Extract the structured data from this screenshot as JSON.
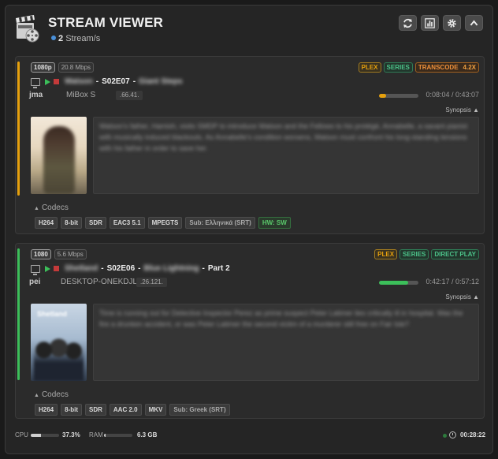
{
  "header": {
    "title": "STREAM VIEWER",
    "stream_count": "2",
    "stream_suffix": "Stream/s",
    "buttons": [
      "refresh-icon",
      "chart-icon",
      "gear-icon",
      "chevron-up-icon"
    ]
  },
  "streams": [
    {
      "resolution": "1080p",
      "bitrate": "20.8 Mbps",
      "tags": {
        "server": "PLEX",
        "type": "SERIES",
        "mode": "TRANSCODE",
        "speed": "4.2X"
      },
      "show": "Watson",
      "episode": "S02E07",
      "episode_title": "Giant Steps",
      "user": "jma",
      "device": "MiBox S",
      "ip": ".66.41.",
      "progress": 0.17,
      "time": "0:08:04 / 0:43:07",
      "synopsis_label": "Synopsis",
      "synopsis": "Watson's father, Hamish, visits SMDP to introduce Watson and the Fellows to his protégé, Annabelle, a savant pianist with musically induced blackouts. As Annabelle's condition worsens, Watson must confront his long-standing tensions with his father in order to save her.",
      "codecs_label": "Codecs",
      "codecs": [
        "H264",
        "8-bit",
        "SDR",
        "EAC3 5.1",
        "MPEGTS"
      ],
      "subtitle": "Sub: Ελληνικά (SRT)",
      "hw": "HW: SW",
      "accent": "#e5a00d",
      "progress_color": "#e5a00d"
    },
    {
      "resolution": "1080",
      "bitrate": "5.6 Mbps",
      "tags": {
        "server": "PLEX",
        "type": "SERIES",
        "mode": "DIRECT PLAY"
      },
      "show": "Shetland",
      "episode": "S02E06",
      "episode_title": "Blue Lightning",
      "episode_part": "Part 2",
      "user": "pei",
      "device": "DESKTOP-ONEKDJL",
      "ip": ".26.121.",
      "progress": 0.74,
      "time": "0:42:17 / 0:57:12",
      "synopsis_label": "Synopsis",
      "synopsis": "Time is running out for Detective Inspector Perez as prime suspect Peter Latimer lies critically ill in hospital. Was the fire a drunken accident, or was Peter Latimer the second victim of a murderer still free on Fair Isle?",
      "poster_title": "Shetland",
      "codecs_label": "Codecs",
      "codecs": [
        "H264",
        "8-bit",
        "SDR",
        "AAC 2.0",
        "MKV"
      ],
      "subtitle": "Sub: Greek (SRT)",
      "accent": "#3cbf5a",
      "progress_color": "#3cbf5a"
    }
  ],
  "footer": {
    "cpu_label": "CPU",
    "cpu_value": "37.3%",
    "cpu_fraction": 0.373,
    "ram_label": "RAM",
    "ram_value": "6.3 GB",
    "ram_fraction": 0.05,
    "elapsed": "00:28:22"
  }
}
